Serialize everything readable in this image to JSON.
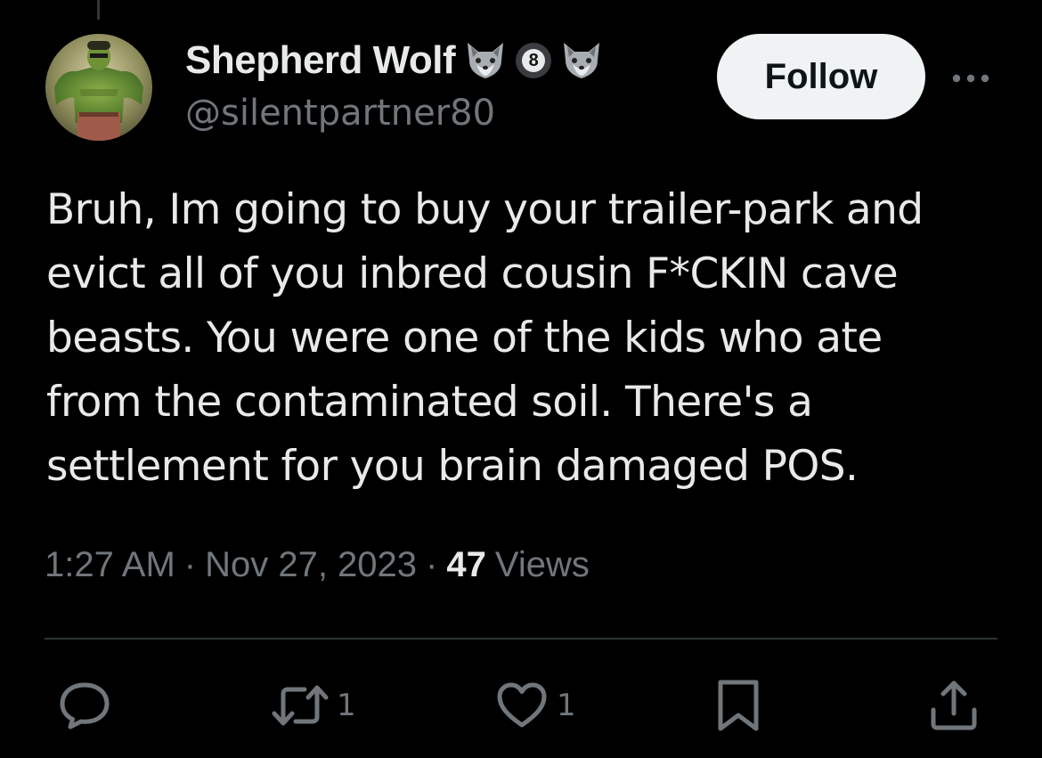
{
  "tweet": {
    "author": {
      "display_name": "Shepherd Wolf",
      "handle": "@silentpartner80",
      "badge_number": "8",
      "badge_icons": [
        "wolf-emoji-icon",
        "number-8-badge-icon",
        "wolf-emoji-icon"
      ]
    },
    "follow_label": "Follow",
    "text_lines": [
      "Bruh, Im going to buy your trailer-park and",
      "evict all of you inbred cousin F*CKIN cave",
      "beasts. You were one of the kids who ate",
      "from the contaminated soil. There's a",
      "settlement for you brain damaged POS."
    ],
    "time": "1:27 AM",
    "separator": "·",
    "date": "Nov 27, 2023",
    "views_count": "47",
    "views_label": "Views"
  },
  "actions": {
    "reply": {
      "icon": "reply-icon",
      "count": ""
    },
    "retweet": {
      "icon": "retweet-icon",
      "count": "1"
    },
    "like": {
      "icon": "heart-icon",
      "count": "1"
    },
    "bookmark": {
      "icon": "bookmark-icon",
      "count": ""
    },
    "share": {
      "icon": "share-icon",
      "count": ""
    }
  },
  "colors": {
    "background": "#000000",
    "text_primary": "#e7e9ea",
    "text_secondary": "#71767b",
    "follow_button_bg": "#eff3f4",
    "divider": "#2f3336"
  }
}
